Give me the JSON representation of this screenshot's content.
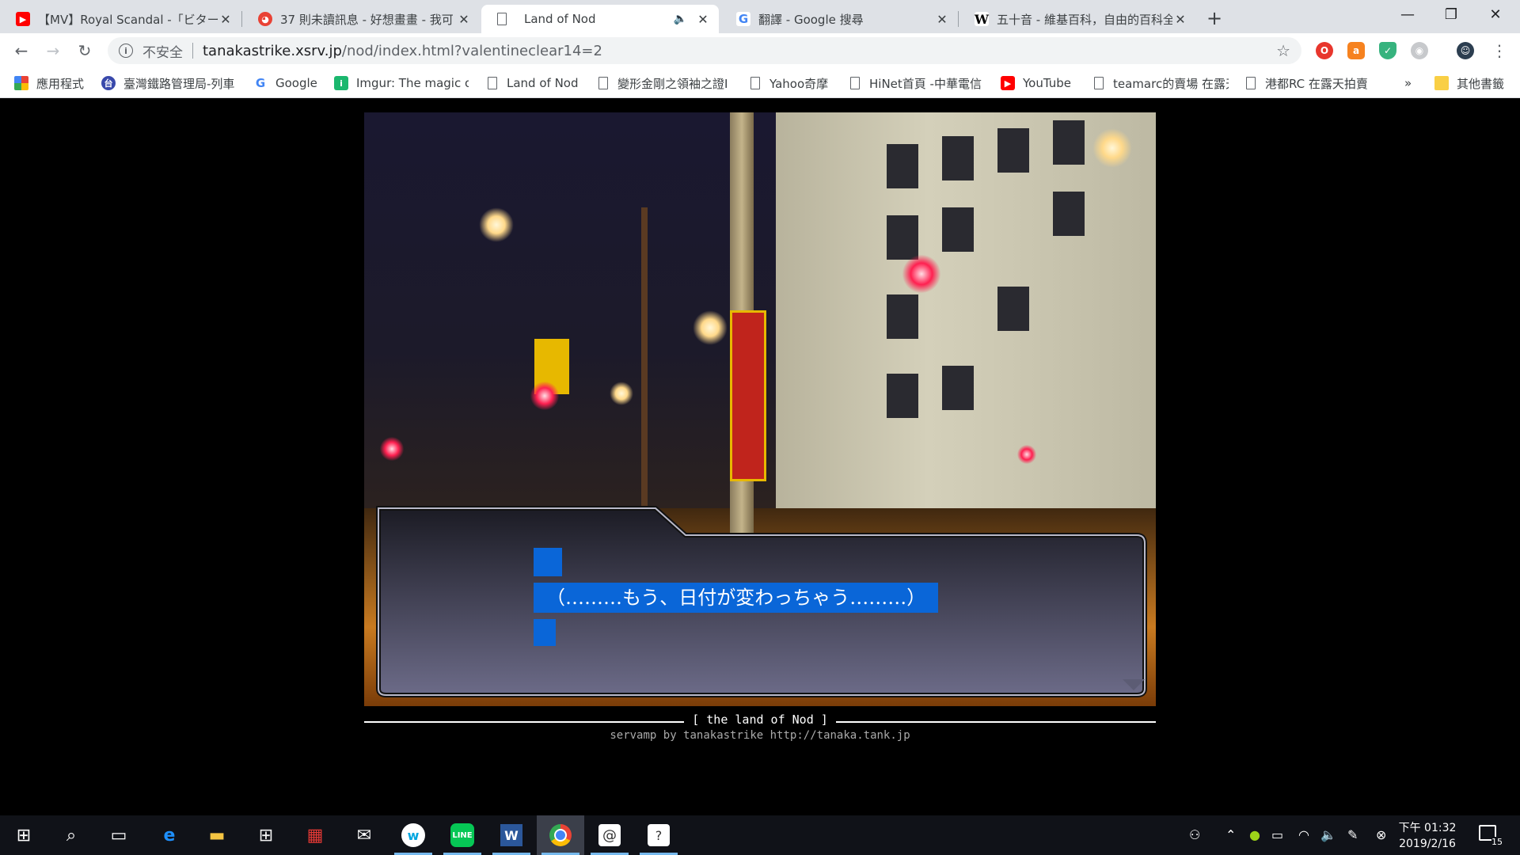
{
  "browser": {
    "tabs": [
      {
        "title": "【MV】Royal Scandal -「ビター",
        "favicon": "youtube-icon",
        "color": "#ff0000",
        "active": false
      },
      {
        "title": "37 則未讀訊息 - 好想畫畫 - 我可",
        "favicon": "chat-icon",
        "color": "#e94235",
        "active": false
      },
      {
        "title": "Land of Nod",
        "favicon": "page-icon",
        "color": "#5f6368",
        "active": true
      },
      {
        "title": "翻譯 - Google 搜尋",
        "favicon": "google-icon",
        "color": "#4285f4",
        "active": false
      },
      {
        "title": "五十音 - 維基百科，自由的百科全",
        "favicon": "wikipedia-icon",
        "color": "#000000",
        "active": false
      }
    ],
    "new_tab": "+",
    "window_controls": {
      "minimize": "—",
      "maximize": "❐",
      "close": "✕"
    },
    "address": {
      "security_label": "不安全",
      "host": "tanakastrike.xsrv.jp",
      "path": "/nod/index.html?valentineclear14=2"
    },
    "bookmarks": [
      {
        "label": "應用程式",
        "icon": "apps-icon"
      },
      {
        "label": "臺灣鐵路管理局-列車",
        "icon": "railway-icon"
      },
      {
        "label": "Google",
        "icon": "google-icon"
      },
      {
        "label": "Imgur: The magic of",
        "icon": "imgur-icon"
      },
      {
        "label": "Land of Nod",
        "icon": "page-icon"
      },
      {
        "label": "變形金剛之領袖之證I",
        "icon": "page-icon"
      },
      {
        "label": "Yahoo奇摩",
        "icon": "page-icon"
      },
      {
        "label": "HiNet首頁 -中華電信",
        "icon": "page-icon"
      },
      {
        "label": "YouTube",
        "icon": "youtube-icon"
      },
      {
        "label": "teamarc的賣場 在露天",
        "icon": "page-icon"
      },
      {
        "label": "港都RC 在露天拍賣",
        "icon": "page-icon"
      }
    ],
    "bookmarks_overflow": "»",
    "other_bookmarks": "其他書籤"
  },
  "game": {
    "dialog_line": "（………もう、日付が変わっちゃう………）",
    "footer_title": "[ the land of Nod ]",
    "footer_credit": "servamp by tanakastrike http://tanaka.tank.jp"
  },
  "taskbar": {
    "apps": [
      "windows-start-icon",
      "search-icon",
      "task-view-icon",
      "edge-icon",
      "file-explorer-icon",
      "store-icon",
      "gift-icon",
      "mail-icon",
      "webtoon-icon",
      "line-icon",
      "word-icon",
      "chrome-icon",
      "app-swirl-icon",
      "app-speech-icon"
    ],
    "clock_time": "下午 01:32",
    "clock_date": "2019/2/16",
    "notification_count": "15"
  }
}
